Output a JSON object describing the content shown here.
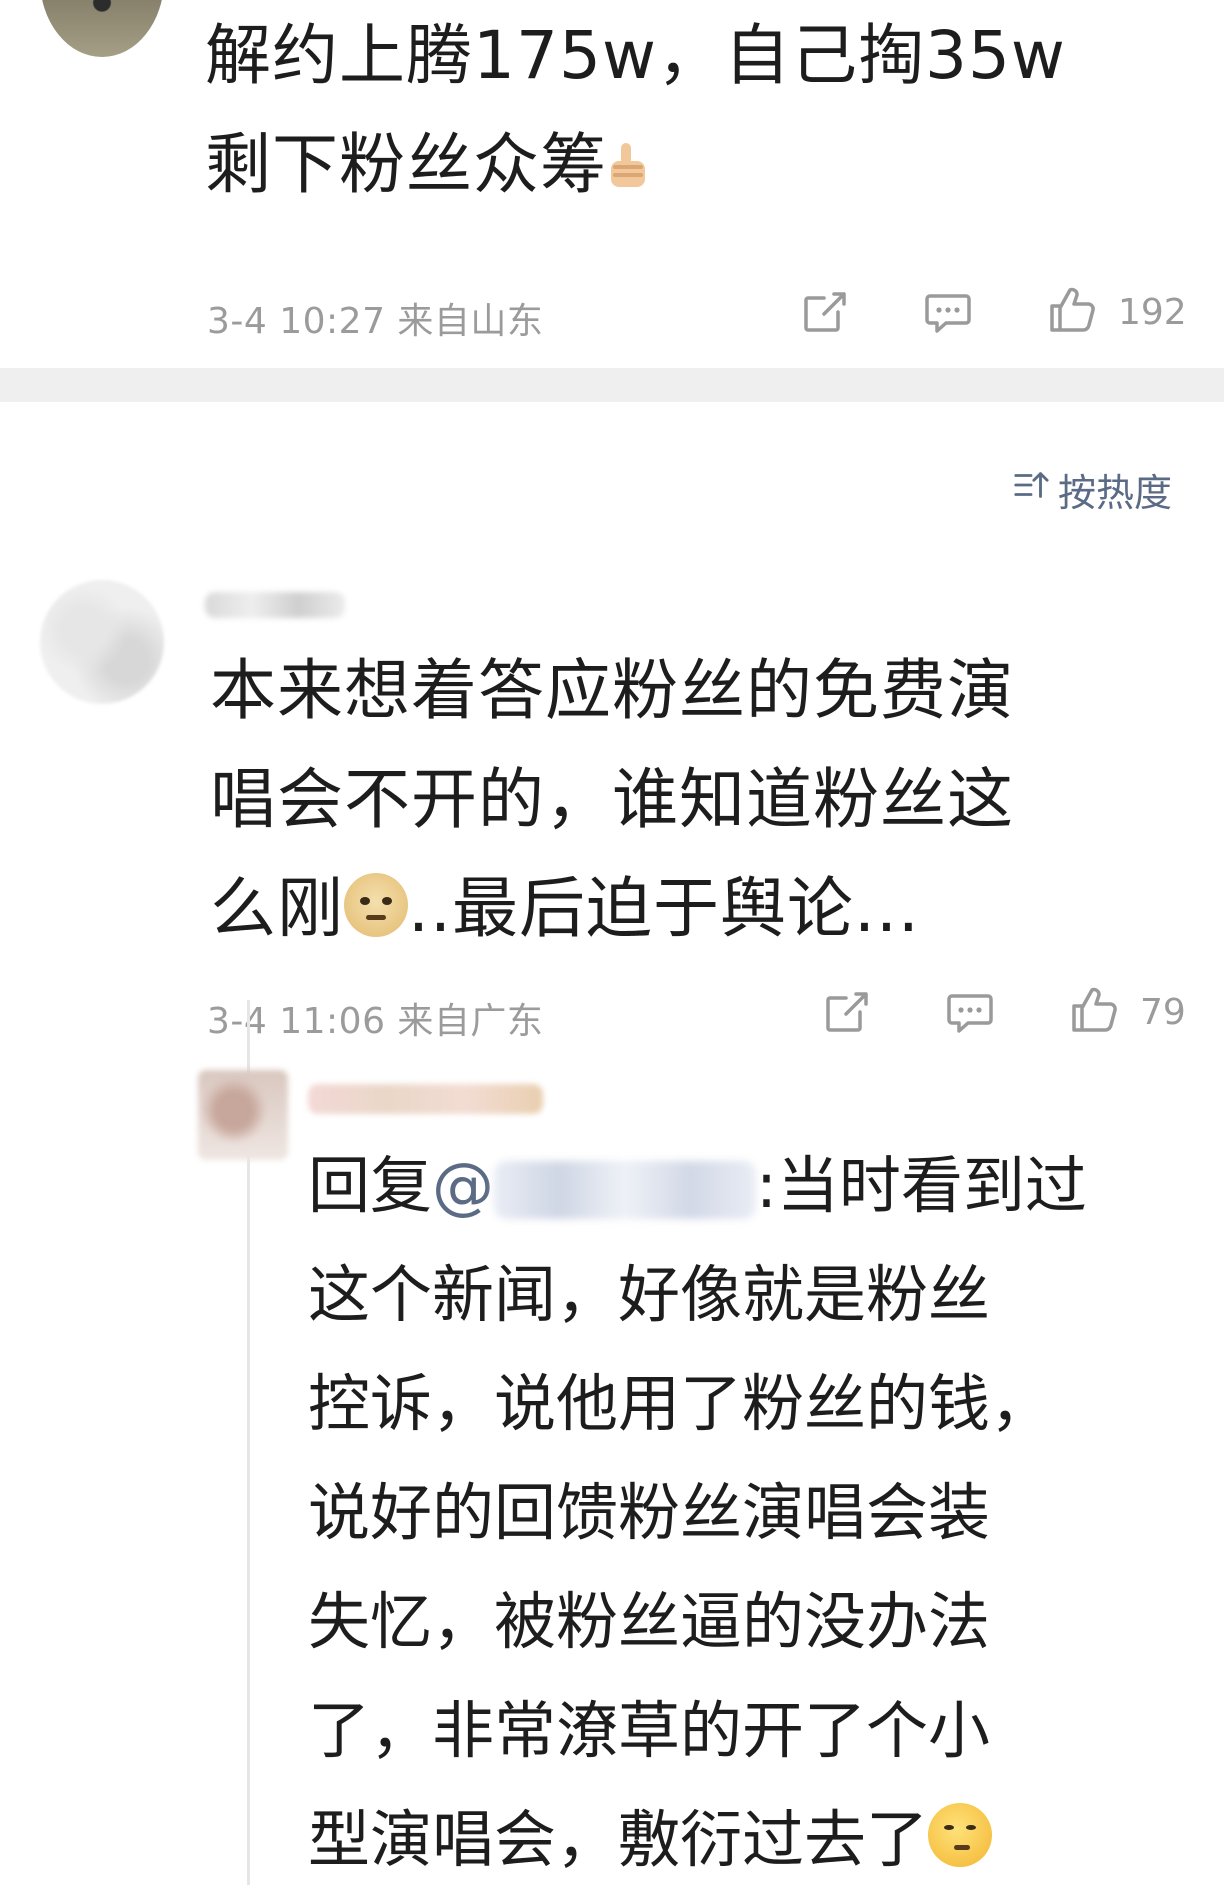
{
  "comment1": {
    "text_line1": "解约上腾175w，自己掏35w",
    "text_line2": "剩下粉丝众筹",
    "emoji": "thumbs-up-emoji",
    "meta": "3-4 10:27 来自山东",
    "like_count": "192"
  },
  "sort": {
    "label": "按热度",
    "icon": "sort-icon"
  },
  "comment2": {
    "text_line1": "本来想着答应粉丝的免费演",
    "text_line2": "唱会不开的，谁知道粉丝这",
    "text_line3_a": "么刚",
    "text_line3_b": "..最后迫于舆论...",
    "emoji": "doge-emoji",
    "meta": "3-4 11:06 来自广东",
    "like_count": "79"
  },
  "reply": {
    "prefix": "回复",
    "at": "@",
    "line1_tail": ":当时看到过",
    "lines": [
      "这个新闻，好像就是粉丝",
      "控诉，说他用了粉丝的钱，",
      "说好的回馈粉丝演唱会装",
      "失忆，被粉丝逼的没办法",
      "了，非常潦草的开了个小"
    ],
    "last_line": "型演唱会，敷衍过去了",
    "emoji": "thinking-emoji"
  },
  "colors": {
    "meta_gray": "#9b9b9b",
    "link_blue": "#5b6b85",
    "divider": "#efefef"
  }
}
